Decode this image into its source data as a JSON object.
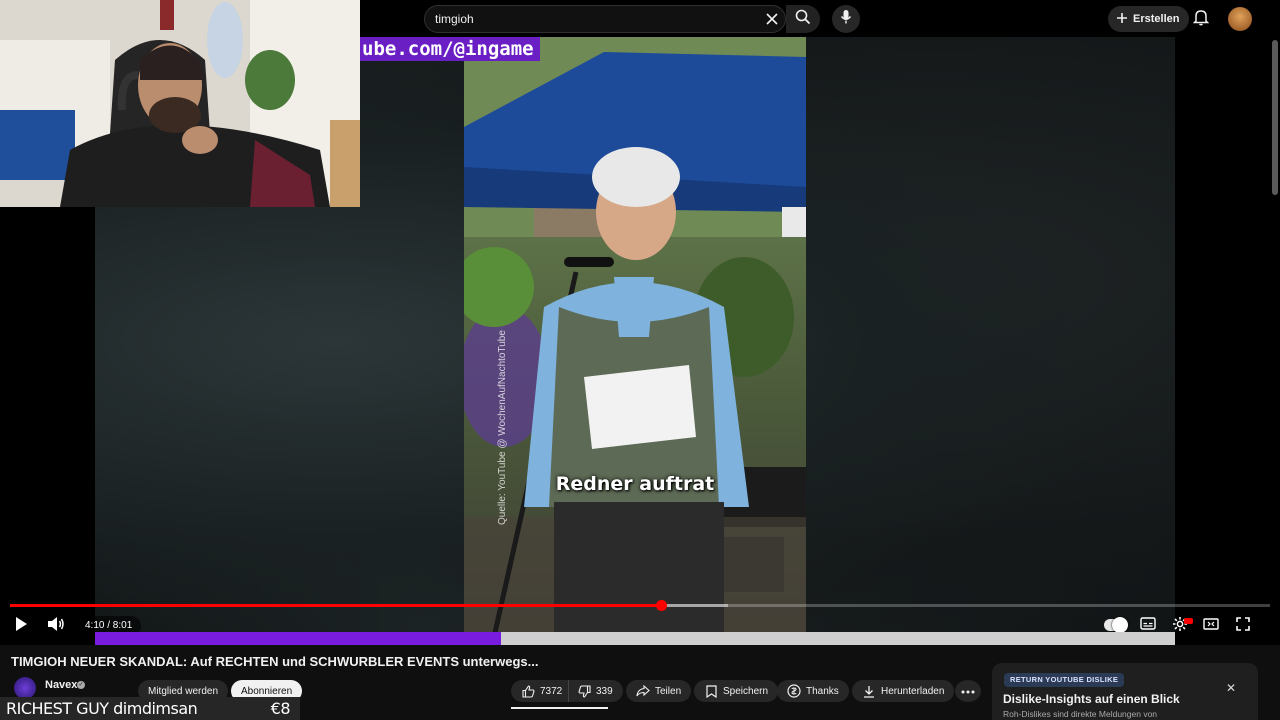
{
  "search": {
    "query": "timgioh"
  },
  "header": {
    "create_label": "Erstellen"
  },
  "video": {
    "url_banner": "ube.com/@ingame",
    "caption": "Redner auftrat",
    "source_text": "Quelle: YouTube @ WochenAufNachtoTube",
    "time": "4:10 / 8:01",
    "progress_fraction": 0.517,
    "buffer_fraction": 0.57,
    "stream_progress_fraction": 0.376
  },
  "title": "TIMGIOH NEUER SKANDAL: Auf RECHTEN und SCHWURBLER EVENTS unterwegs...",
  "channel": {
    "name": "Navex"
  },
  "actions": {
    "member_label": "Mitglied werden",
    "subscribe_label": "Abonnieren",
    "likes": "7372",
    "dislikes": "339",
    "share_label": "Teilen",
    "save_label": "Speichern",
    "thanks_label": "Thanks",
    "download_label": "Herunterladen"
  },
  "ticker": {
    "left_text": "RICHEST GUY dimdimsan",
    "right_text": "€8"
  },
  "dislike_card": {
    "badge": "RETURN YOUTUBE DISLIKE",
    "heading": "Dislike-Insights auf einen Blick",
    "sub": "Roh-Dislikes sind direkte Meldungen von"
  },
  "colors": {
    "accent_red": "#ff0000",
    "stream_purple": "#7a1be0",
    "banner_purple": "#6a1fc4"
  }
}
